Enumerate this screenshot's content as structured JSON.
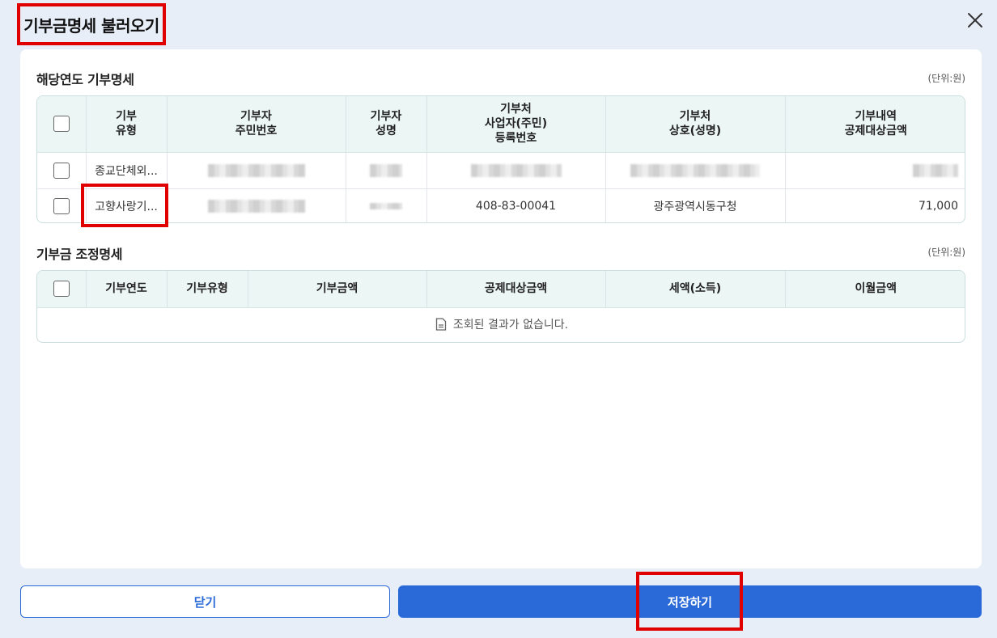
{
  "modal": {
    "title": "기부금명세 불러오기"
  },
  "section1": {
    "title": "해당연도 기부명세",
    "unit": "(단위:원)",
    "headers": [
      [
        "기부",
        "유형"
      ],
      [
        "기부자",
        "주민번호"
      ],
      [
        "기부자",
        "성명"
      ],
      [
        "기부처",
        "사업자(주민)",
        "등록번호"
      ],
      [
        "기부처",
        "상호(성명)"
      ],
      [
        "기부내역",
        "공제대상금액"
      ]
    ],
    "rows": [
      {
        "type": "종교단체외...",
        "reg_no": "",
        "name": "",
        "biz_no": "",
        "org_name": "",
        "amount": ""
      },
      {
        "type": "고향사랑기...",
        "reg_no": "",
        "name": "",
        "biz_no": "408-83-00041",
        "org_name": "광주광역시동구청",
        "amount": "71,000"
      }
    ]
  },
  "section2": {
    "title": "기부금 조정명세",
    "unit": "(단위:원)",
    "headers": [
      "기부연도",
      "기부유형",
      "기부금액",
      "공제대상금액",
      "세액(소득)",
      "이월금액"
    ],
    "empty_message": "조회된 결과가 없습니다."
  },
  "footer": {
    "close_label": "닫기",
    "save_label": "저장하기"
  },
  "colors": {
    "primary": "#2a6ad8",
    "highlight": "#e00000",
    "header_bg": "#ecf6f5",
    "page_bg": "#e8eef8"
  }
}
